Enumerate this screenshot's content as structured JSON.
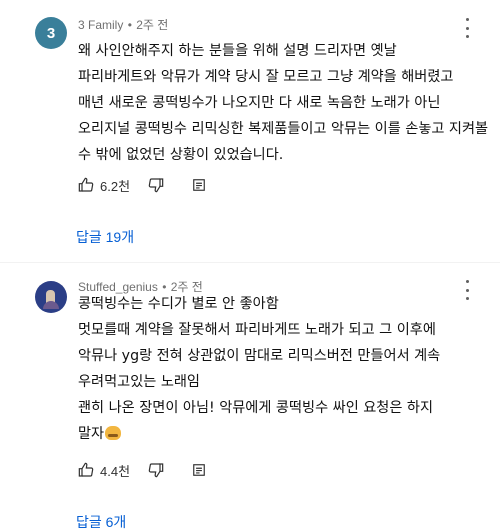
{
  "comments": [
    {
      "author": "3 Family",
      "separator": "•",
      "time": "2주 전",
      "avatar_letter": "3",
      "lines": [
        "왜 사인안해주지 하는 분들을 위해 설명 드리자면 옛날",
        "파리바게트와 악뮤가 계약 당시 잘 모르고 그냥 계약을 해버렸고",
        "매년 새로운 콩떡빙수가 나오지만 다 새로 녹음한 노래가 아닌",
        "오리지널 콩떡빙수 리믹싱한 복제품들이고 악뮤는 이를 손놓고 지켜볼",
        "수 밖에 없었던 상황이 있었습니다."
      ],
      "likes": "6.2천",
      "replies": "답글 19개"
    },
    {
      "author": "Stuffed_genius",
      "separator": "•",
      "time": "2주 전",
      "lines": [
        "콩떡빙수는 수디가 별로 안 좋아함",
        "멋모를때 계약을 잘못해서 파리바게뜨 노래가 되고 그 이후에",
        "악뮤나 yg랑 전혀 상관없이 맘대로 리믹스버전 만들어서 계속",
        "우려먹고있는 노래임",
        "괜히 나온 장면이 아님! 악뮤에게 콩떡빙수 싸인 요청은 하지",
        "말자"
      ],
      "likes": "4.4천",
      "replies": "답글 6개"
    }
  ],
  "icons": [
    "thumb-up-icon",
    "thumb-down-icon",
    "reply-icon",
    "more-vert-icon",
    "grin-emoji-icon"
  ],
  "colors": {
    "link": "#065fd4",
    "meta": "#707070",
    "avatar1": "#3a7f9a",
    "avatar2": "#2b3e86"
  }
}
